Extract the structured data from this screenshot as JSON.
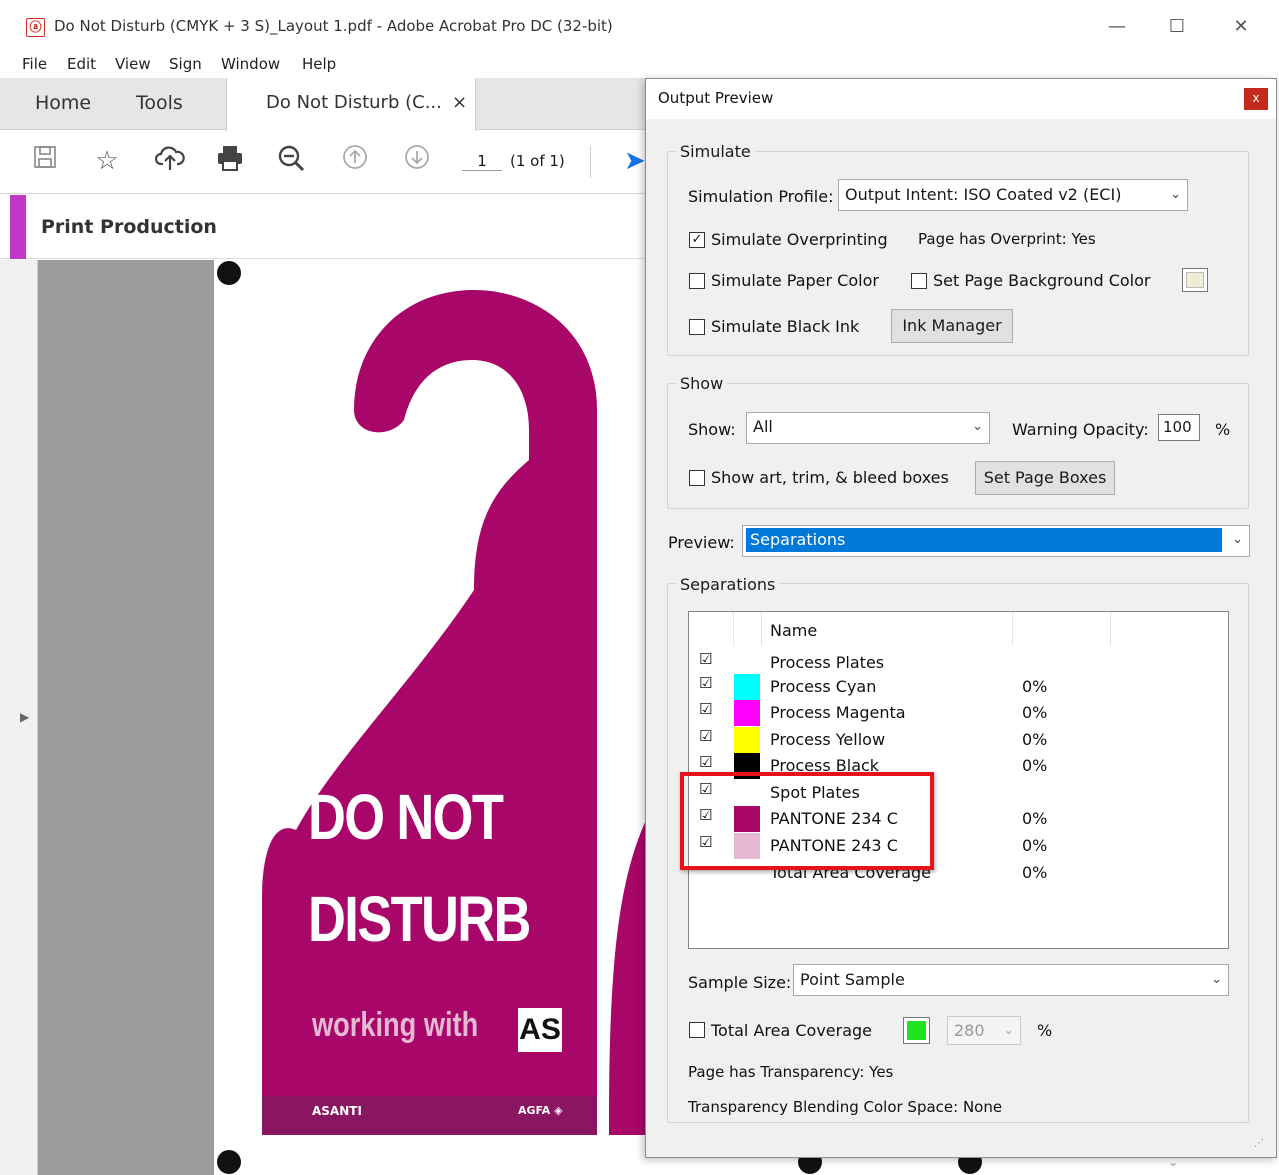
{
  "window": {
    "title": "Do Not Disturb (CMYK + 3 S)_Layout 1.pdf - Adobe Acrobat Pro DC (32-bit)",
    "min": "—",
    "max": "☐",
    "close": "✕"
  },
  "menu": [
    "File",
    "Edit",
    "View",
    "Sign",
    "Window",
    "Help"
  ],
  "tabs": {
    "home": "Home",
    "tools": "Tools",
    "doc": "Do Not Disturb (C...",
    "doc_close": "×"
  },
  "toolbar": {
    "page_num": "1",
    "page_of": "(1 of 1)"
  },
  "panel": {
    "title": "Print Production"
  },
  "artwork": {
    "line1": "DO NOT",
    "line2": "DISTURB",
    "tagline": "working with",
    "logo": "AS",
    "footer_left": "ASANTI",
    "footer_right": "AGFA ◈",
    "color": "#a80669"
  },
  "dialog": {
    "title": "Output Preview",
    "close": "x",
    "simulate": {
      "group": "Simulate",
      "profile_label": "Simulation Profile:",
      "profile_value": "Output Intent: ISO Coated v2 (ECI)",
      "overprinting": "Simulate Overprinting",
      "overprint_status": "Page has Overprint:  Yes",
      "paper_color": "Simulate Paper Color",
      "page_bg": "Set Page Background Color",
      "black_ink": "Simulate Black Ink",
      "ink_manager": "Ink Manager"
    },
    "show": {
      "group": "Show",
      "show_label": "Show:",
      "show_value": "All",
      "opacity_label": "Warning Opacity:",
      "opacity_value": "100",
      "opacity_unit": "%",
      "boxes": "Show art, trim, & bleed boxes",
      "set_boxes": "Set Page Boxes"
    },
    "preview_label": "Preview:",
    "preview_value": "Separations",
    "separations": {
      "group": "Separations",
      "col_name": "Name",
      "rows": [
        {
          "name": "Process Plates",
          "value": "",
          "color": "",
          "checked": "☑"
        },
        {
          "name": "Process Cyan",
          "value": "0%",
          "color": "#00ffff",
          "checked": "☑"
        },
        {
          "name": "Process Magenta",
          "value": "0%",
          "color": "#ff00ff",
          "checked": "☑"
        },
        {
          "name": "Process Yellow",
          "value": "0%",
          "color": "#ffff00",
          "checked": "☑"
        },
        {
          "name": "Process Black",
          "value": "0%",
          "color": "#000000",
          "checked": "☑"
        },
        {
          "name": "Spot Plates",
          "value": "",
          "color": "",
          "checked": "☑"
        },
        {
          "name": "PANTONE 234 C",
          "value": "0%",
          "color": "#a80669",
          "checked": "☑"
        },
        {
          "name": "PANTONE 243 C",
          "value": "0%",
          "color": "#e6b8d4",
          "checked": "☑"
        },
        {
          "name": "Total Area Coverage",
          "value": "0%",
          "color": "",
          "checked": ""
        }
      ]
    },
    "sample_label": "Sample Size:",
    "sample_value": "Point Sample",
    "tac_label": "Total Area Coverage",
    "tac_value": "280",
    "tac_unit": "%",
    "transparency": "Page has Transparency:  Yes",
    "blend_space": "Transparency Blending Color Space:  None"
  }
}
